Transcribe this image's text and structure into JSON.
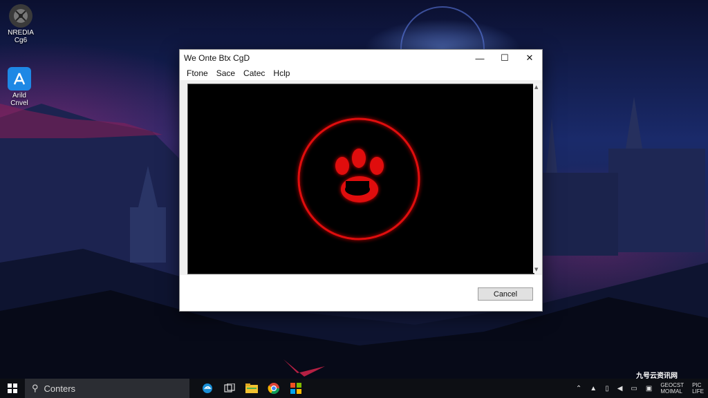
{
  "desktop": {
    "icons": [
      {
        "label_line1": "NREDIA",
        "label_line2": "Cg6"
      },
      {
        "label_line1": "Arild",
        "label_line2": "Cnvel"
      }
    ]
  },
  "window": {
    "title": "We Onte Btx CgD",
    "controls": {
      "minimize": "—",
      "maximize": "☐",
      "close": "✕"
    },
    "menu": [
      "Ftone",
      "Sace",
      "Catec",
      "Hclp"
    ],
    "cancel_label": "Cancel",
    "accent_color": "#e01010"
  },
  "taskbar": {
    "search_text": "Conters",
    "tray_clock_line1": "GEOCST",
    "tray_clock_line2": "MOIMAL",
    "tray_extra_line1": "PIC",
    "tray_extra_line2": "LIFE",
    "watermark": "九号云资讯网"
  }
}
